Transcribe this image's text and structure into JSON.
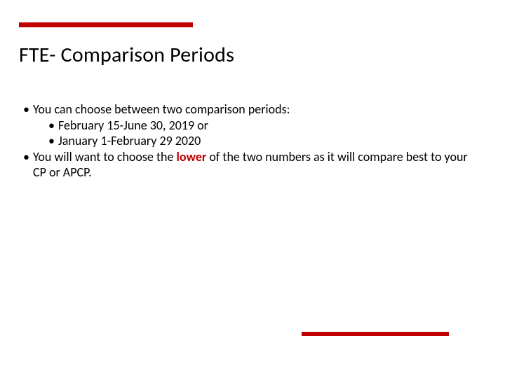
{
  "colors": {
    "accent": "#c00000"
  },
  "title": "FTE- Comparison Periods",
  "body": {
    "line1": "You can choose between two comparison periods:",
    "line1a": "February 15-June 30, 2019 or",
    "line1b": "January 1-February 29 2020",
    "line2_pre": "You will want to choose the ",
    "line2_lower": "lower",
    "line2_post": " of the two numbers as it will compare best to your CP or APCP."
  }
}
